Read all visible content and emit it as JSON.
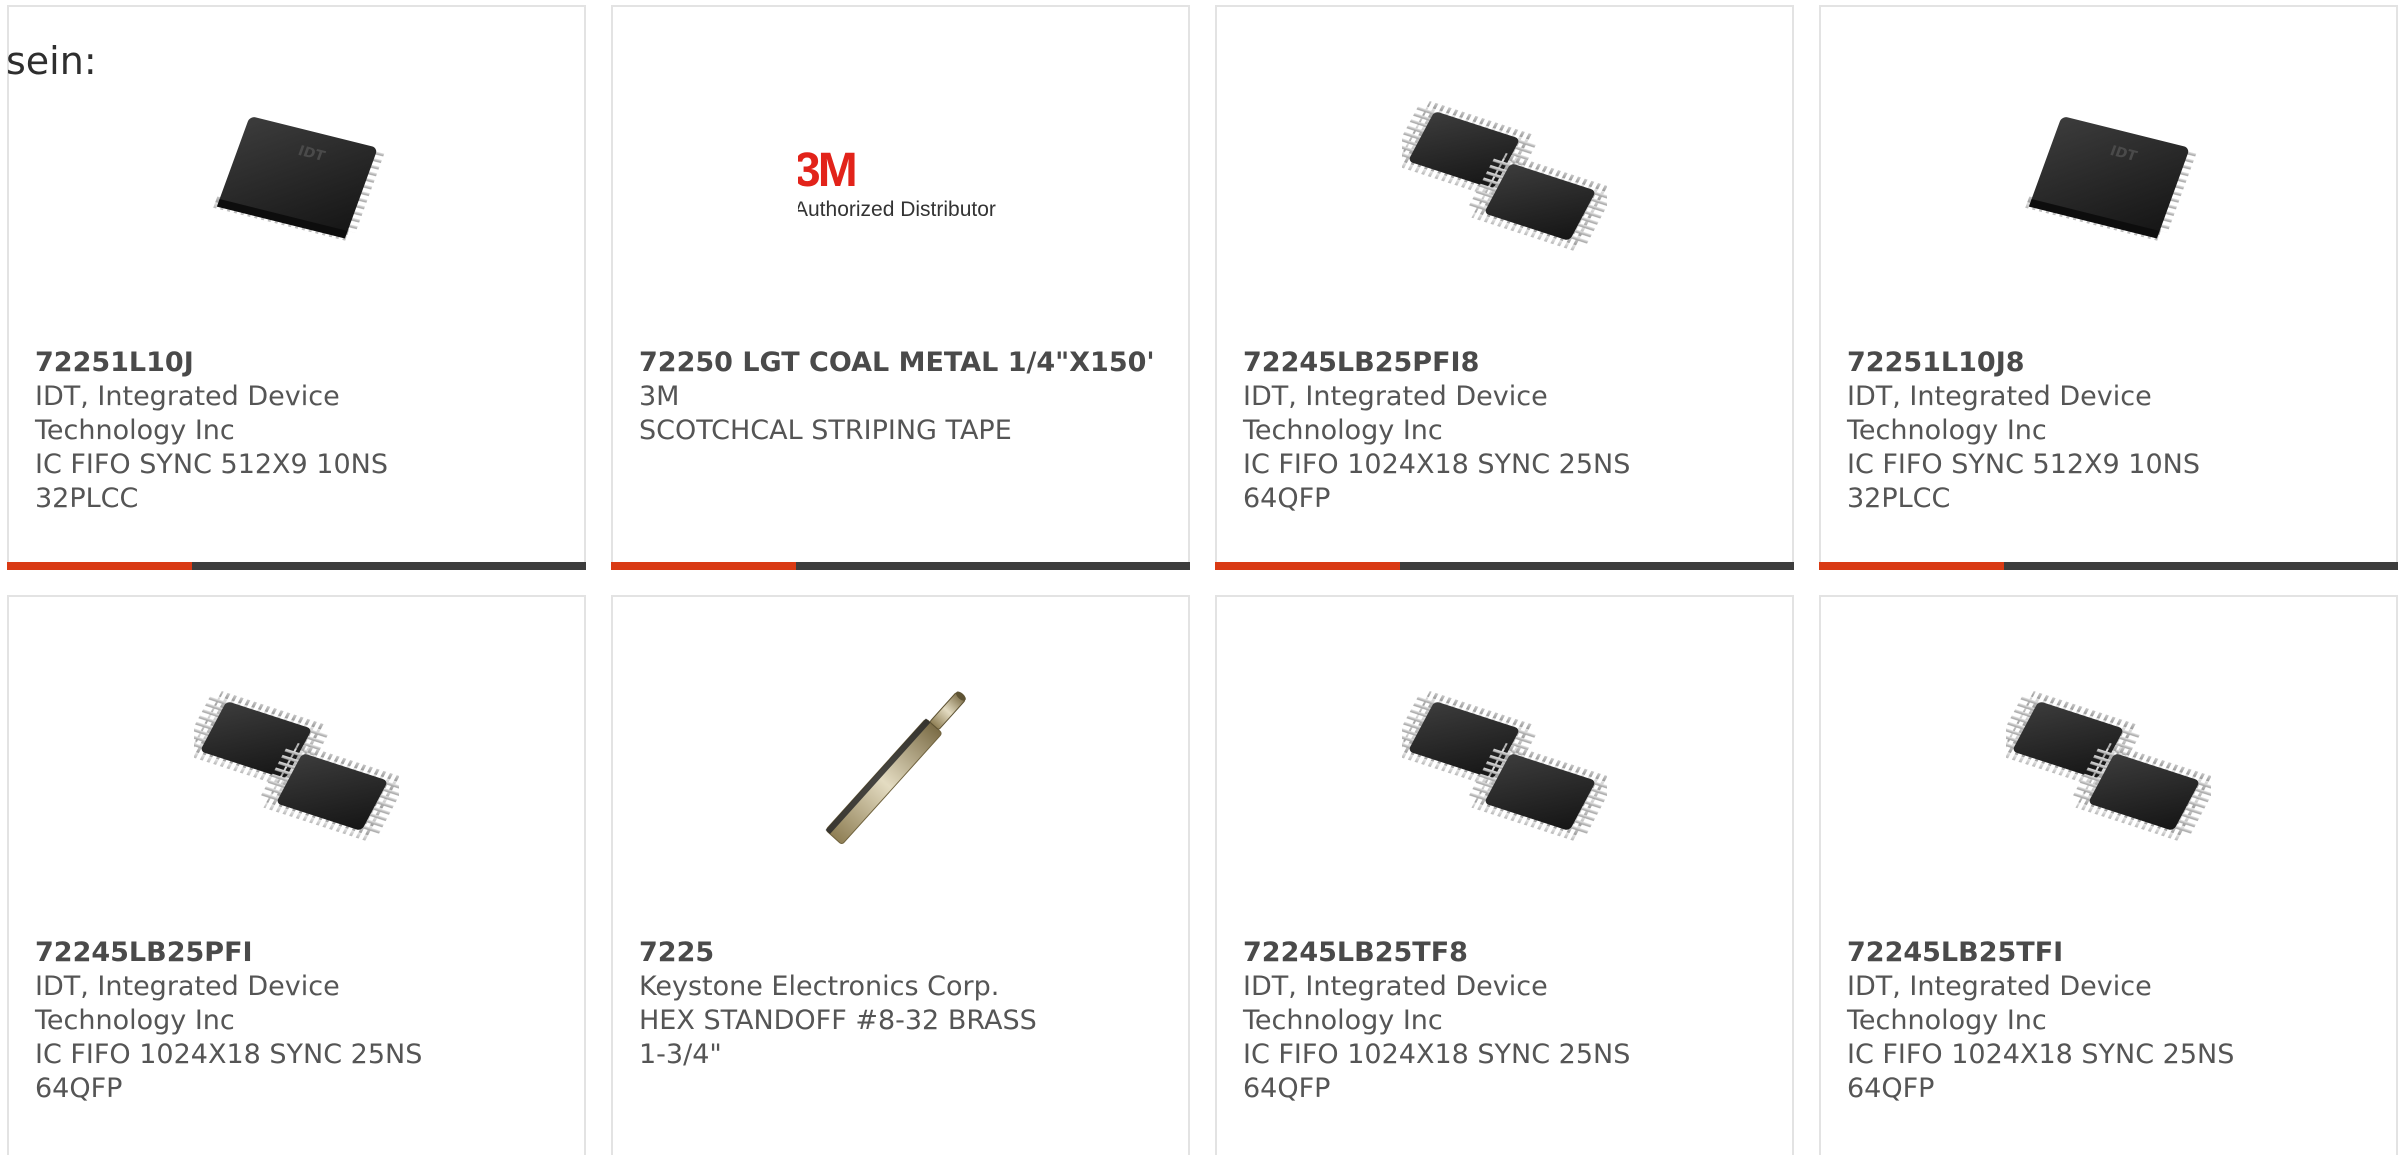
{
  "lead_text": "sein:",
  "colors": {
    "accent_bar": "#d93a14",
    "base_bar": "#3d3d3d",
    "card_border": "#e3e3e3",
    "brand_3m": "#e2231a"
  },
  "products": [
    {
      "part_number": "72251L10J",
      "manufacturer": "IDT, Integrated Device Technology Inc",
      "description": "IC FIFO SYNC 512X9 10NS 32PLCC",
      "image_icon": "plcc-chip-icon"
    },
    {
      "part_number": "72250 LGT COAL METAL 1/4\"X150'",
      "manufacturer": "3M",
      "description": "SCOTCHCAL STRIPING TAPE",
      "image_icon": "3m-authorized-distributor-logo",
      "logo_brand": "3M",
      "logo_caption": "Authorized Distributor"
    },
    {
      "part_number": "72245LB25PFI8",
      "manufacturer": "IDT, Integrated Device Technology Inc",
      "description": "IC FIFO 1024X18 SYNC 25NS 64QFP",
      "image_icon": "qfp-chips-icon"
    },
    {
      "part_number": "72251L10J8",
      "manufacturer": "IDT, Integrated Device Technology Inc",
      "description": "IC FIFO SYNC 512X9 10NS 32PLCC",
      "image_icon": "plcc-chip-icon"
    },
    {
      "part_number": "72245LB25PFI",
      "manufacturer": "IDT, Integrated Device Technology Inc",
      "description": "IC FIFO 1024X18 SYNC 25NS 64QFP",
      "image_icon": "qfp-chips-icon"
    },
    {
      "part_number": "7225",
      "manufacturer": "Keystone Electronics Corp.",
      "description": "HEX STANDOFF #8-32 BRASS 1-3/4\"",
      "image_icon": "hex-standoff-icon"
    },
    {
      "part_number": "72245LB25TF8",
      "manufacturer": "IDT, Integrated Device Technology Inc",
      "description": "IC FIFO 1024X18 SYNC 25NS 64QFP",
      "image_icon": "qfp-chips-icon"
    },
    {
      "part_number": "72245LB25TFI",
      "manufacturer": "IDT, Integrated Device Technology Inc",
      "description": "IC FIFO 1024X18 SYNC 25NS 64QFP",
      "image_icon": "qfp-chips-icon"
    }
  ]
}
